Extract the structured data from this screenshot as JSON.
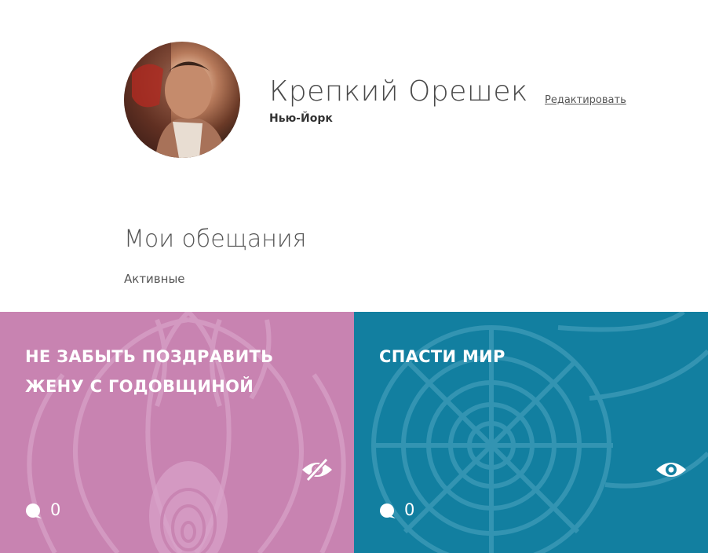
{
  "profile": {
    "name": "Крепкий Орешек",
    "city": "Нью-Йорк",
    "edit_label": "Редактировать",
    "avatar_icon": "user-photo"
  },
  "promises": {
    "title": "Мои обещания",
    "filter_label": "Активные",
    "cards": [
      {
        "title": "НЕ ЗАБЫТЬ ПОЗДРАВИТЬ ЖЕНУ С ГОДОВЩИНОЙ",
        "comments": "0",
        "visibility_icon": "eye-slash-icon",
        "color": "#c883b1"
      },
      {
        "title": "СПАСТИ МИР",
        "comments": "0",
        "visibility_icon": "eye-icon",
        "color": "#127fa0"
      }
    ]
  }
}
